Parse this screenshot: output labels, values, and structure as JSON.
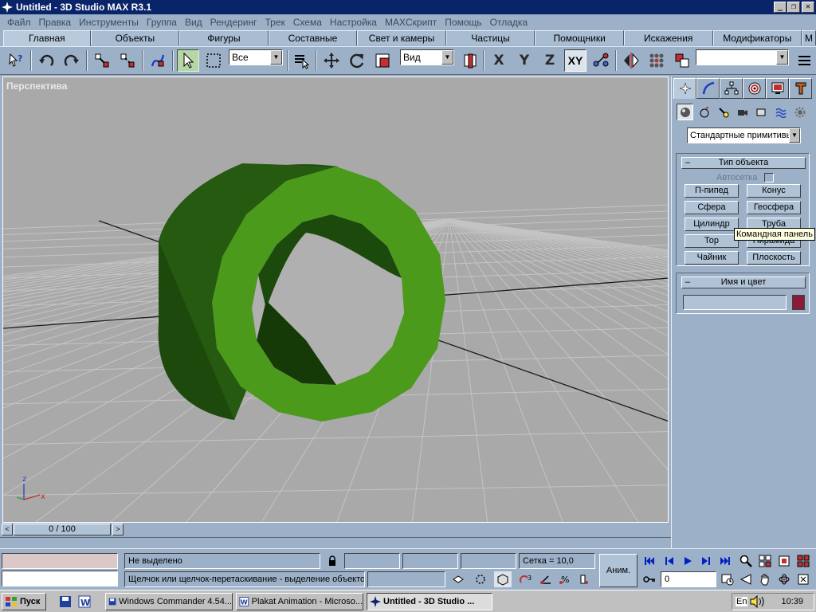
{
  "window": {
    "title": "Untitled - 3D Studio MAX R3.1",
    "buttons": [
      "_",
      "❐",
      "✕"
    ]
  },
  "menu": [
    "Файл",
    "Правка",
    "Инструменты",
    "Группа",
    "Вид",
    "Рендеринг",
    "Трек",
    "Схема",
    "Настройка",
    "MAXСкрипт",
    "Помощь",
    "Отладка"
  ],
  "tabs": [
    "Главная",
    "Объекты",
    "Фигуры",
    "Составные объекты",
    "Свет и камеры",
    "Частицы",
    "Помощники",
    "Искажения",
    "Модификаторы",
    "М"
  ],
  "toolbar": {
    "selection_filter": "Все",
    "ref_coord": "Вид",
    "named_selection": "",
    "axis_x": "X",
    "axis_y": "Y",
    "axis_z": "Z",
    "axis_xy": "XY"
  },
  "viewport": {
    "label": "Перспектива",
    "tooltip": "Командная панель",
    "axis_z": "z",
    "axis_x": "x"
  },
  "timeline": {
    "frame_display": "0 / 100",
    "prev": "<",
    "next": ">"
  },
  "command_panel": {
    "category": "Стандартные примитивы",
    "object_type_title": "Тип объекта",
    "autogrid_label": "Автосетка",
    "object_buttons": [
      "П-пипед",
      "Конус",
      "Сфера",
      "Геосфера",
      "Цилиндр",
      "Труба",
      "Тор",
      "Пирамида",
      "Чайник",
      "Плоскость"
    ],
    "name_color_title": "Имя и цвет",
    "name_value": "",
    "color": "#8b1a3a"
  },
  "status": {
    "selection": "Не выделено",
    "prompt": "Щелчок или щелчок-перетаскивание - выделение объектов",
    "grid": "Сетка = 10,0",
    "anim_button": "Аним.",
    "frame_value": "0"
  },
  "taskbar": {
    "start": "Пуск",
    "tasks": [
      "Windows Commander 4.54...",
      "Plakat Animation - Microso...",
      "Untitled - 3D Studio ..."
    ],
    "lang": "En",
    "clock": "10:39"
  },
  "colors": {
    "ui_bg": "#9cb0c8",
    "title_bg": "#0a246a",
    "viewport_bg": "#a9a9a9",
    "tube_front": "#4c9a1c",
    "tube_dark": "#1e4a0e"
  }
}
